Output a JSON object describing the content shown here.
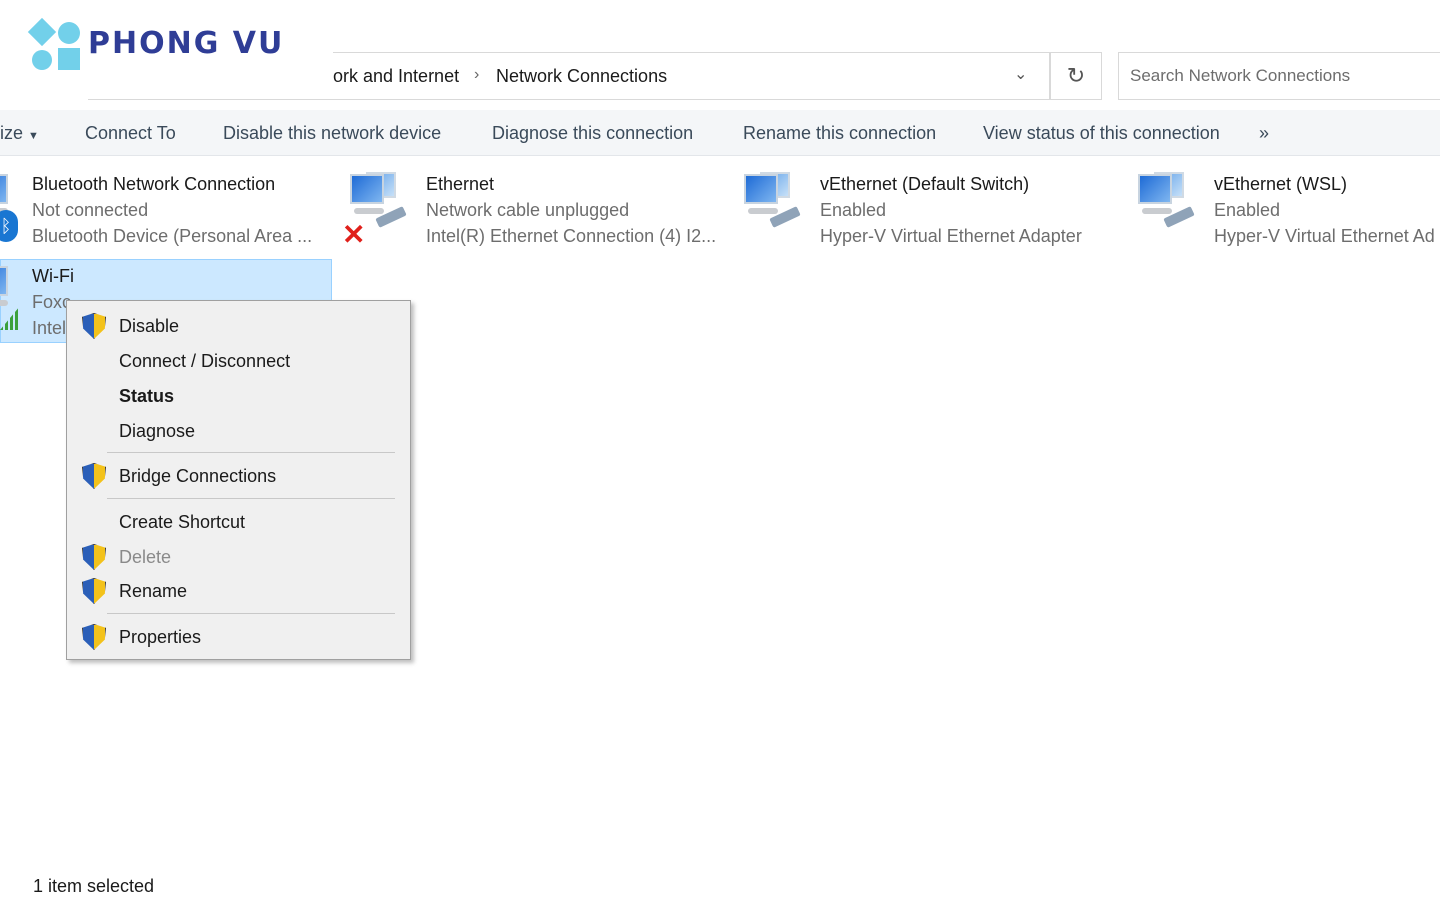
{
  "logo": {
    "text": "PHONG VU"
  },
  "address": {
    "crumbs": [
      "ork and Internet",
      "Network Connections"
    ]
  },
  "search": {
    "placeholder": "Search Network Connections"
  },
  "toolbar": {
    "organize": "ize",
    "connect_to": "Connect To",
    "disable": "Disable this network device",
    "diagnose": "Diagnose this connection",
    "rename": "Rename this connection",
    "view_status": "View status of this connection",
    "more": "»"
  },
  "connections": [
    {
      "name": "Bluetooth Network Connection",
      "status": "Not connected",
      "device": "Bluetooth Device (Personal Area ..."
    },
    {
      "name": "Ethernet",
      "status": "Network cable unplugged",
      "device": "Intel(R) Ethernet Connection (4) I2..."
    },
    {
      "name": "vEthernet (Default Switch)",
      "status": "Enabled",
      "device": "Hyper-V Virtual Ethernet Adapter"
    },
    {
      "name": "vEthernet (WSL)",
      "status": "Enabled",
      "device": "Hyper-V Virtual Ethernet Ad"
    },
    {
      "name": "Wi-Fi",
      "status": "Foxc",
      "device": "Intel"
    }
  ],
  "context_menu": {
    "items": [
      "Disable",
      "Connect / Disconnect",
      "Status",
      "Diagnose",
      "Bridge Connections",
      "Create Shortcut",
      "Delete",
      "Rename",
      "Properties"
    ]
  },
  "statusbar": {
    "selection": "1 item selected"
  },
  "colors": {
    "selection": "#cce8ff",
    "logo_blue": "#2f3d96",
    "logo_cyan": "#72d0ea"
  }
}
